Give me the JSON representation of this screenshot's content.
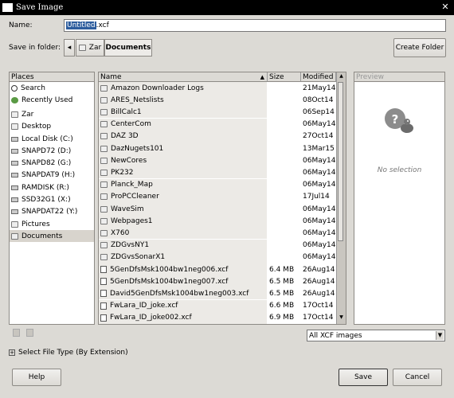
{
  "window": {
    "title": "Save Image"
  },
  "name_label": "Name:",
  "name_value_selected": "Untitled",
  "name_value_ext": ".xcf",
  "save_in_label": "Save in folder:",
  "path": {
    "back": "◂",
    "zar": "Zar",
    "documents": "Documents"
  },
  "create_folder": "Create Folder",
  "places": {
    "header": "Places",
    "items": [
      {
        "label": "Search",
        "icon": "search-icon"
      },
      {
        "label": "Recently Used",
        "icon": "recent-icon"
      },
      {
        "label": "Zar",
        "icon": "folder-icon"
      },
      {
        "label": "Desktop",
        "icon": "folder-icon"
      },
      {
        "label": "Local Disk (C:)",
        "icon": "disk-icon"
      },
      {
        "label": "SNAPD72 (D:)",
        "icon": "disk-icon"
      },
      {
        "label": "SNAPD82 (G:)",
        "icon": "disk-icon"
      },
      {
        "label": "SNAPDAT9 (H:)",
        "icon": "disk-icon"
      },
      {
        "label": "RAMDISK (R:)",
        "icon": "disk-icon"
      },
      {
        "label": "SSD32G1 (X:)",
        "icon": "disk-icon"
      },
      {
        "label": "SNAPDAT22 (Y:)",
        "icon": "disk-icon"
      },
      {
        "label": "Pictures",
        "icon": "folder-icon"
      },
      {
        "label": "Documents",
        "icon": "folder-icon"
      }
    ]
  },
  "files": {
    "headers": {
      "name": "Name",
      "size": "Size",
      "modified": "Modified"
    },
    "rows": [
      {
        "name": "Amazon Downloader Logs",
        "size": "",
        "modified": "21May14",
        "type": "folder"
      },
      {
        "name": "ARES_Netslists",
        "size": "",
        "modified": "08Oct14",
        "type": "folder"
      },
      {
        "name": "BillCalc1",
        "size": "",
        "modified": "06Sep14",
        "type": "folder"
      },
      {
        "name": "CenterCom",
        "size": "",
        "modified": "06May14",
        "type": "folder"
      },
      {
        "name": "DAZ 3D",
        "size": "",
        "modified": "27Oct14",
        "type": "folder"
      },
      {
        "name": "DazNugets101",
        "size": "",
        "modified": "13Mar15",
        "type": "folder"
      },
      {
        "name": "NewCores",
        "size": "",
        "modified": "06May14",
        "type": "folder"
      },
      {
        "name": "PK232",
        "size": "",
        "modified": "06May14",
        "type": "folder"
      },
      {
        "name": "Planck_Map",
        "size": "",
        "modified": "06May14",
        "type": "folder"
      },
      {
        "name": "ProPCCleaner",
        "size": "",
        "modified": "17Jul14",
        "type": "folder"
      },
      {
        "name": "WaveSim",
        "size": "",
        "modified": "06May14",
        "type": "folder"
      },
      {
        "name": "Webpages1",
        "size": "",
        "modified": "06May14",
        "type": "folder"
      },
      {
        "name": "X760",
        "size": "",
        "modified": "06May14",
        "type": "folder"
      },
      {
        "name": "ZDGvsNY1",
        "size": "",
        "modified": "06May14",
        "type": "folder"
      },
      {
        "name": "ZDGvsSonarX1",
        "size": "",
        "modified": "06May14",
        "type": "folder"
      },
      {
        "name": "5GenDfsMsk1004bw1neg006.xcf",
        "size": "6.4 MB",
        "modified": "26Aug14",
        "type": "doc"
      },
      {
        "name": "5GenDfsMsk1004bw1neg007.xcf",
        "size": "6.5 MB",
        "modified": "26Aug14",
        "type": "doc"
      },
      {
        "name": "David5GenDfsMsk1004bw1neg003.xcf",
        "size": "6.5 MB",
        "modified": "26Aug14",
        "type": "doc"
      },
      {
        "name": "FwLara_ID_joke.xcf",
        "size": "6.6 MB",
        "modified": "17Oct14",
        "type": "doc"
      },
      {
        "name": "FwLara_ID_joke002.xcf",
        "size": "6.9 MB",
        "modified": "17Oct14",
        "type": "doc"
      }
    ]
  },
  "preview": {
    "header": "Preview",
    "empty": "No selection"
  },
  "filter": {
    "selected": "All XCF images"
  },
  "select_file_type": "Select File Type (By Extension)",
  "buttons": {
    "help": "Help",
    "save": "Save",
    "cancel": "Cancel"
  }
}
